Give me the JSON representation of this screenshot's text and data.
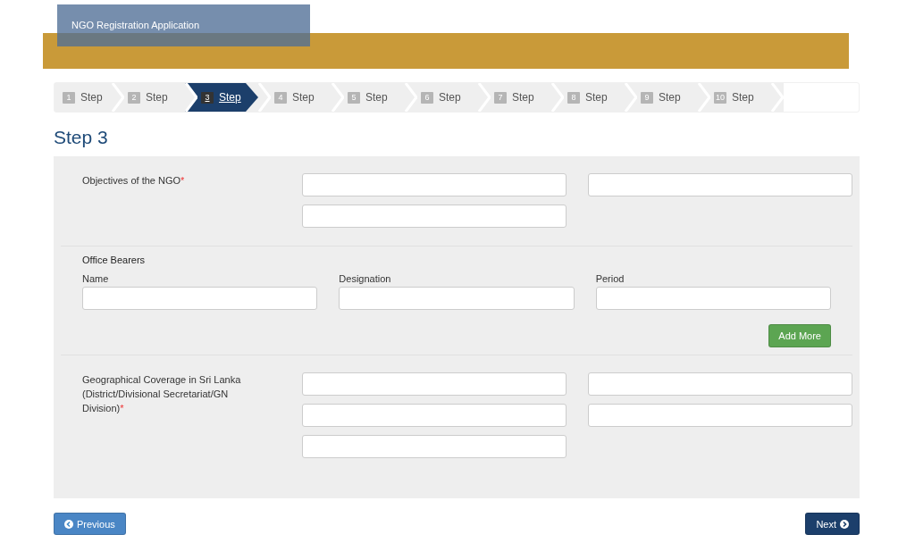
{
  "header": {
    "title": "NGO Registration Application"
  },
  "steps": [
    {
      "number": "1",
      "label": "Step",
      "selected": false
    },
    {
      "number": "2",
      "label": "Step",
      "selected": false
    },
    {
      "number": "3",
      "label": "Step",
      "selected": true
    },
    {
      "number": "4",
      "label": "Step",
      "selected": false
    },
    {
      "number": "5",
      "label": "Step",
      "selected": false
    },
    {
      "number": "6",
      "label": "Step",
      "selected": false
    },
    {
      "number": "7",
      "label": "Step",
      "selected": false
    },
    {
      "number": "8",
      "label": "Step",
      "selected": false
    },
    {
      "number": "9",
      "label": "Step",
      "selected": false
    },
    {
      "number": "10",
      "label": "Step",
      "selected": false
    }
  ],
  "heading": "Step 3",
  "sections": [
    {
      "kind": "side",
      "label": "Objectives of the NGO",
      "required_mark": "*",
      "fields": [
        {
          "kind": "text"
        },
        {
          "kind": "text"
        },
        {
          "kind": "text"
        }
      ]
    },
    {
      "kind": "table",
      "title": "Office Bearers",
      "columns": [
        {
          "label": "Name"
        },
        {
          "label": "Designation"
        },
        {
          "label": "Period"
        }
      ],
      "button": "Add More"
    },
    {
      "kind": "side",
      "label": "Geographical Coverage in Sri Lanka (District/Divisional Secretariat/GN Division)",
      "required_mark": "*",
      "fields": [
        {
          "kind": "text"
        },
        {
          "kind": "text"
        },
        {
          "kind": "text"
        },
        {
          "kind": "text"
        },
        {
          "kind": "text"
        }
      ]
    }
  ],
  "footer": {
    "previous": "Previous",
    "next": "Next"
  }
}
